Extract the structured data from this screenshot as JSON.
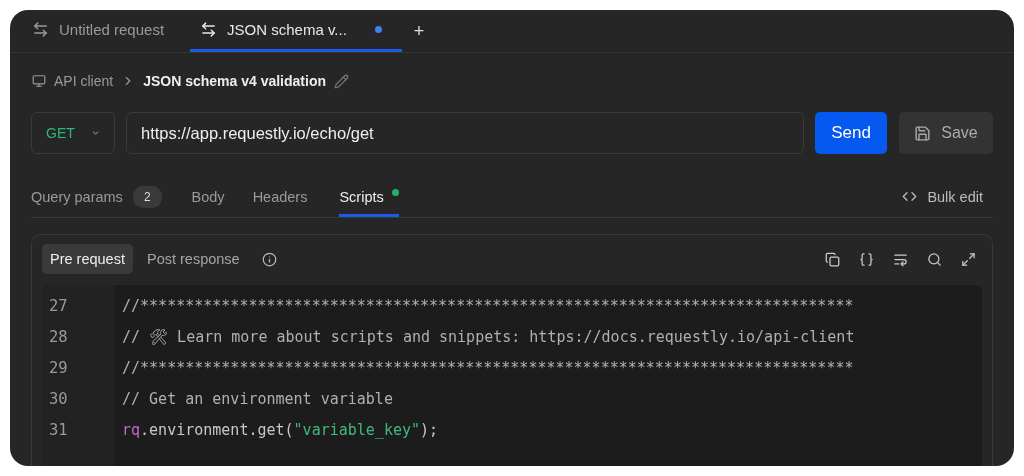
{
  "tabs": [
    {
      "label": "Untitled request",
      "selected": false,
      "unsaved": false
    },
    {
      "label": "JSON schema v...",
      "selected": true,
      "unsaved": true
    }
  ],
  "new_tab": "+",
  "breadcrumb": {
    "parent": "API client",
    "title": "JSON schema v4 validation"
  },
  "request": {
    "method": "GET",
    "url": "https://app.requestly.io/echo/get",
    "send": "Send",
    "save": "Save"
  },
  "section_tabs": [
    {
      "label": "Query params",
      "badge": "2",
      "selected": false,
      "dot": false
    },
    {
      "label": "Body",
      "selected": false,
      "dot": false
    },
    {
      "label": "Headers",
      "selected": false,
      "dot": false
    },
    {
      "label": "Scripts",
      "selected": true,
      "dot": true
    }
  ],
  "bulk_edit": "Bulk edit",
  "script_tabs": [
    {
      "label": "Pre request",
      "selected": true
    },
    {
      "label": "Post response",
      "selected": false
    }
  ],
  "code": [
    {
      "number": "27",
      "tokens": [
        {
          "kind": "comment",
          "text": "//*******************************************************************************"
        }
      ]
    },
    {
      "number": "28",
      "tokens": [
        {
          "kind": "comment",
          "text": "// 🛠 Learn more about scripts and snippets: https://docs.requestly.io/api-client"
        }
      ]
    },
    {
      "number": "29",
      "tokens": [
        {
          "kind": "comment",
          "text": "//*******************************************************************************"
        }
      ]
    },
    {
      "number": "30",
      "tokens": [
        {
          "kind": "comment",
          "text": "// Get an environment variable"
        }
      ]
    },
    {
      "number": "31",
      "tokens": [
        {
          "kind": "keyword",
          "text": "rq"
        },
        {
          "kind": "plain",
          "text": ".environment.get("
        },
        {
          "kind": "string",
          "text": "\"variable_key\""
        },
        {
          "kind": "plain",
          "text": ");"
        }
      ]
    }
  ]
}
